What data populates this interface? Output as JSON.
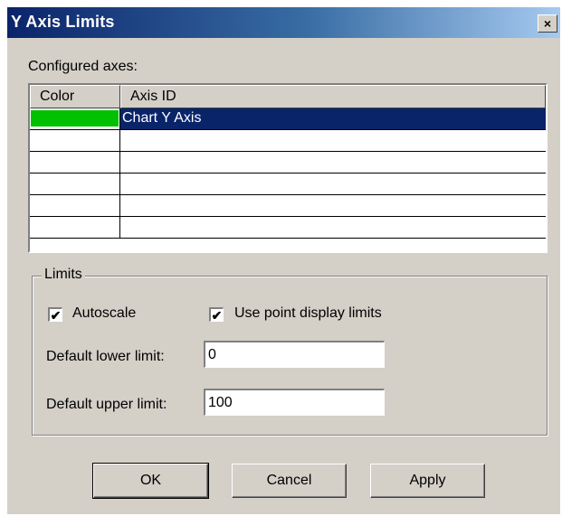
{
  "window": {
    "title": "Y Axis Limits",
    "close_symbol": "×"
  },
  "axes": {
    "label": "Configured axes:",
    "columns": [
      "Color",
      "Axis ID"
    ],
    "rows": [
      {
        "color": "#00c000",
        "axis_id": "Chart Y Axis",
        "selected": true
      },
      {
        "color": "",
        "axis_id": "",
        "selected": false
      },
      {
        "color": "",
        "axis_id": "",
        "selected": false
      },
      {
        "color": "",
        "axis_id": "",
        "selected": false
      },
      {
        "color": "",
        "axis_id": "",
        "selected": false
      },
      {
        "color": "",
        "axis_id": "",
        "selected": false
      }
    ]
  },
  "limits": {
    "group_label": "Limits",
    "autoscale": {
      "label": "Autoscale",
      "checked": true
    },
    "use_point_display": {
      "label": "Use point display limits",
      "checked": true
    },
    "lower": {
      "label": "Default lower limit:",
      "value": "0"
    },
    "upper": {
      "label": "Default upper limit:",
      "value": "100"
    },
    "check_mark": "✔"
  },
  "buttons": {
    "ok": "OK",
    "cancel": "Cancel",
    "apply": "Apply"
  },
  "colors": {
    "title_gradient_start": "#0a246a",
    "dialog_bg": "#d4d0c8",
    "selection": "#0a246a"
  }
}
